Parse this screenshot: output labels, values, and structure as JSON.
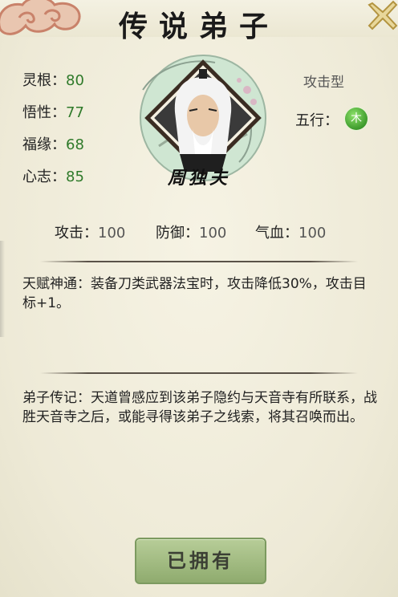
{
  "header": {
    "title": "传说弟子"
  },
  "stats": [
    {
      "label": "灵根",
      "value": "80"
    },
    {
      "label": "悟性",
      "value": "77"
    },
    {
      "label": "福缘",
      "value": "68"
    },
    {
      "label": "心志",
      "value": "85"
    }
  ],
  "disciple": {
    "name": "周独夫",
    "type": "攻击型",
    "wuxing_label": "五行：",
    "wuxing_value": "木"
  },
  "attributes": [
    {
      "label": "攻击：",
      "value": "100"
    },
    {
      "label": "防御：",
      "value": "100"
    },
    {
      "label": "气血：",
      "value": "100"
    }
  ],
  "talent": {
    "text": "天赋神通：装备刀类武器法宝时，攻击降低30%，攻击目标+1。"
  },
  "biography": {
    "text": "弟子传记：天道曾感应到该弟子隐约与天音寺有所联系，战胜天音寺之后，或能寻得该弟子之线索，将其召唤而出。"
  },
  "button": {
    "label": "已拥有"
  },
  "colors": {
    "stat_value": "#2f7a2a",
    "button": "#a3bd83",
    "panel": "#f1eedd"
  },
  "icons": [
    "close-icon",
    "cloud-ornament-icon",
    "wood-element-icon",
    "portrait-icon"
  ]
}
